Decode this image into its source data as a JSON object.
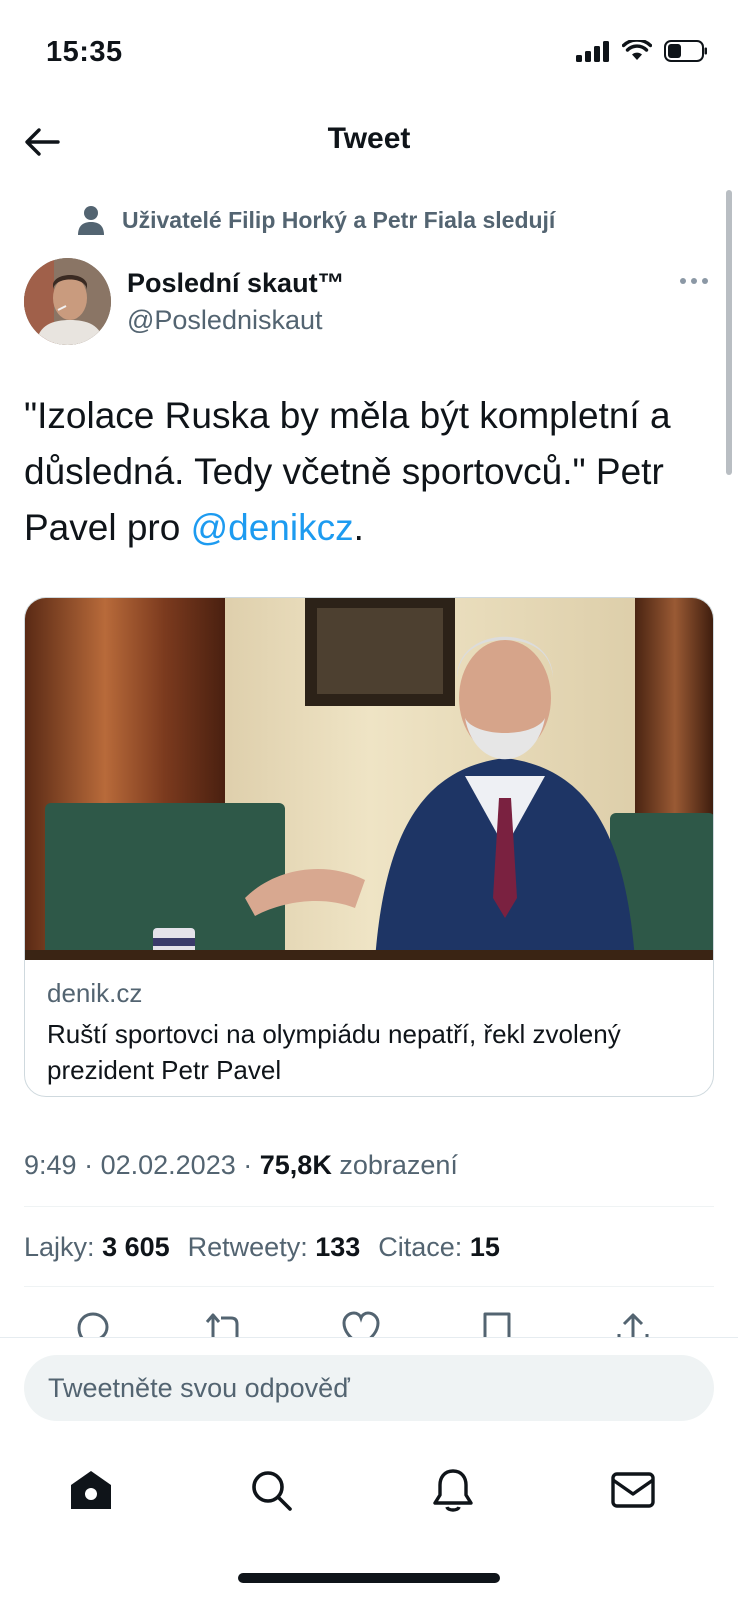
{
  "status_bar": {
    "time": "15:35"
  },
  "header": {
    "title": "Tweet"
  },
  "social_context": {
    "text": "Uživatelé Filip Horký a Petr Fiala sledují"
  },
  "author": {
    "name": "Poslední skaut™",
    "handle": "@Posledniskaut"
  },
  "tweet": {
    "text_before_mention": "\"Izolace Ruska by měla být kompletní a důsledná. Tedy včetně sportovců.\" Petr Pavel pro ",
    "mention": "@denikcz",
    "text_after_mention": "."
  },
  "link_card": {
    "domain": "denik.cz",
    "title": "Ruští sportovci na olympiádu nepatří, řekl zvolený prezident Petr Pavel"
  },
  "meta": {
    "time": "9:49",
    "separator": "·",
    "date": "02.02.2023",
    "views_count": "75,8K",
    "views_label": "zobrazení"
  },
  "stats": {
    "likes_label": "Lajky:",
    "likes_count": "3 605",
    "retweets_label": "Retweety:",
    "retweets_count": "133",
    "quotes_label": "Citace:",
    "quotes_count": "15"
  },
  "actions": [
    "reply-icon",
    "retweet-icon",
    "like-icon",
    "bookmark-icon",
    "share-icon"
  ],
  "reply": {
    "placeholder": "Tweetněte svou odpověď"
  },
  "tab_bar": [
    "home-icon",
    "search-icon",
    "notifications-icon",
    "messages-icon"
  ],
  "colors": {
    "accent": "#1d9bf0",
    "text": "#0f1419",
    "secondary": "#536471"
  }
}
